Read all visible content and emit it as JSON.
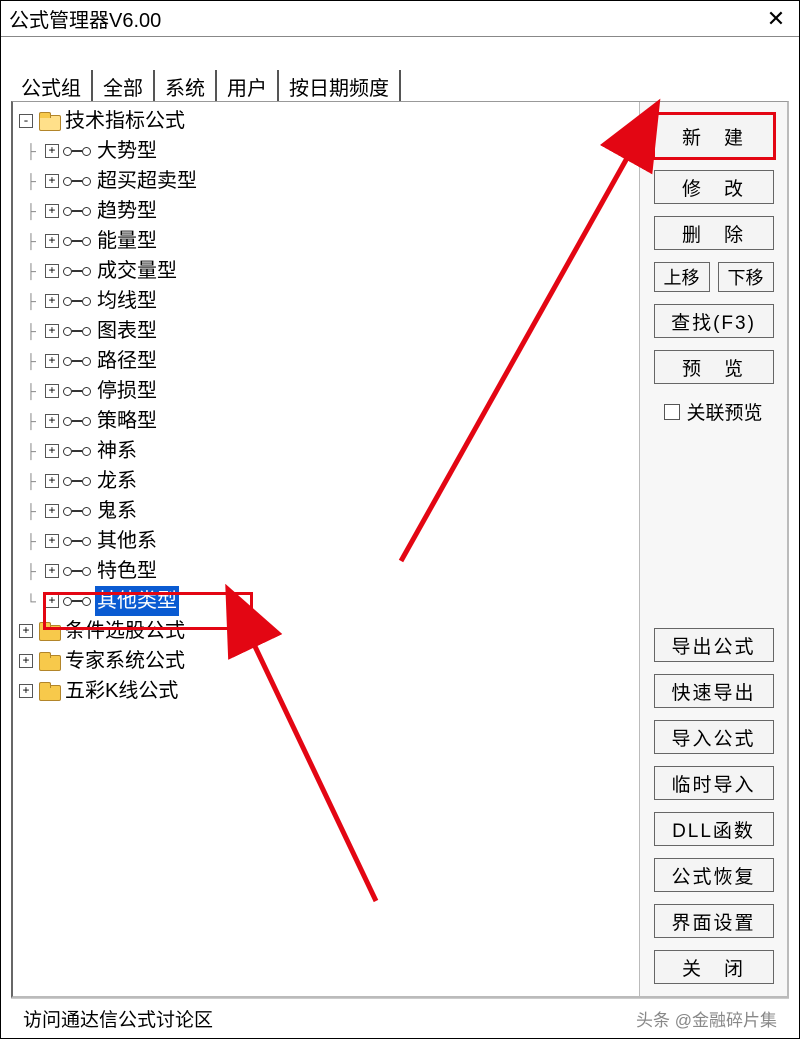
{
  "window": {
    "title": "公式管理器V6.00",
    "close_label": "✕"
  },
  "tabs": {
    "t0": "公式组",
    "t1": "全部",
    "t2": "系统",
    "t3": "用户",
    "t4": "按日期频度"
  },
  "tree": {
    "root0": "技术指标公式",
    "c0": "大势型",
    "c1": "超买超卖型",
    "c2": "趋势型",
    "c3": "能量型",
    "c4": "成交量型",
    "c5": "均线型",
    "c6": "图表型",
    "c7": "路径型",
    "c8": "停损型",
    "c9": "策略型",
    "c10": "神系",
    "c11": "龙系",
    "c12": "鬼系",
    "c13": "其他系",
    "c14": "特色型",
    "c15": "其他类型",
    "root1": "条件选股公式",
    "root2": "专家系统公式",
    "root3": "五彩K线公式"
  },
  "side": {
    "new": "新　建",
    "edit": "修　改",
    "delete": "删　除",
    "up": "上移",
    "down": "下移",
    "find": "查找(F3)",
    "preview": "预　览",
    "link_preview": "关联预览",
    "export": "导出公式",
    "quick_export": "快速导出",
    "import": "导入公式",
    "temp_import": "临时导入",
    "dll": "DLL函数",
    "restore": "公式恢复",
    "ui_settings": "界面设置",
    "close": "关　闭"
  },
  "footer": {
    "link": "访问通达信公式讨论区",
    "watermark": "头条 @金融碎片集"
  }
}
